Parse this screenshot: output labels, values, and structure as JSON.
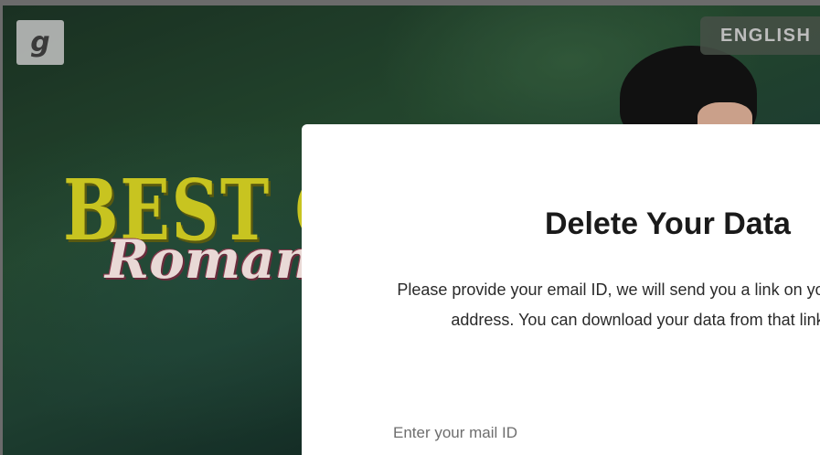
{
  "header": {
    "logo_letter": "g",
    "language_label": "ENGLISH"
  },
  "hero": {
    "poster_title": "BEST G",
    "poster_subtitle": "Romance"
  },
  "modal": {
    "title": "Delete Your Data",
    "description": "Please provide your email ID, we will send you a link on your email address. You can download your data from that link.",
    "email_input": {
      "placeholder": "Enter your mail ID",
      "value": ""
    }
  }
}
